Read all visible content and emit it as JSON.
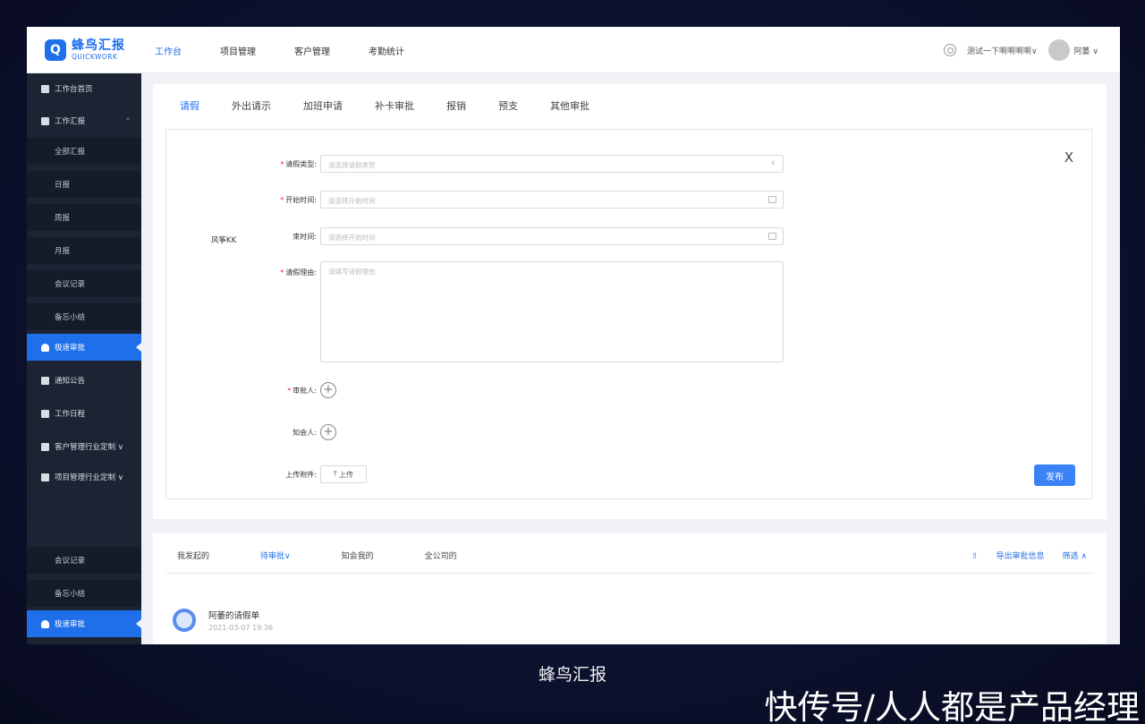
{
  "app": {
    "logo_cn": "蜂鸟汇报",
    "logo_en": "QUICKWORK",
    "brand_color": "#1f6feb"
  },
  "topnav": {
    "items": [
      "工作台",
      "项目管理",
      "客户管理",
      "考勤统计"
    ],
    "active_index": 0,
    "company": "测试一下啊啊啊啊∨",
    "user": "阿萎 ∨"
  },
  "sidebar": {
    "items": [
      {
        "label": "工作台首页",
        "icon": "grid-icon"
      },
      {
        "label": "工作汇报",
        "icon": "microphone-icon",
        "expanded": true
      },
      {
        "label": "全部汇报"
      },
      {
        "label": "日报"
      },
      {
        "label": "周报"
      },
      {
        "label": "月报"
      },
      {
        "label": "会议记录"
      },
      {
        "label": "备忘小结"
      },
      {
        "label": "极速审批",
        "icon": "user-icon",
        "active": true
      },
      {
        "label": "通知公告",
        "icon": "speaker-icon"
      },
      {
        "label": "工作日程",
        "icon": "calendar-icon"
      },
      {
        "label": "客户管理行业定制 ∨",
        "icon": "users-icon"
      },
      {
        "label": "项目管理行业定制 ∨",
        "icon": "folder-icon"
      },
      {
        "label": "会议记录"
      },
      {
        "label": "备忘小结"
      },
      {
        "label": "极速审批",
        "icon": "user-icon",
        "active": true
      }
    ]
  },
  "approval_tabs": [
    "请假",
    "外出请示",
    "加班申请",
    "补卡审批",
    "报销",
    "预支",
    "其他审批"
  ],
  "form": {
    "leave_type_label": "请假类型:",
    "leave_type_placeholder": "请选择请假类型",
    "start_label": "开始时间:",
    "start_placeholder": "请选择开始时间",
    "end_label": "结束时间:",
    "end_label_visible": "束时间:",
    "end_placeholder": "请选择开始时间",
    "reason_label": "请假理由:",
    "reason_placeholder": "请填写请假理由",
    "approver_label": "审批人:",
    "cc_label": "知会人:",
    "attachment_label": "上传附件:",
    "upload_button": "上传",
    "publish_button": "发布",
    "close_symbol": "X",
    "tooltip_user": "风筝KK"
  },
  "list_panel": {
    "tabs": [
      "我发起的",
      "待审批∨",
      "知会我的",
      "全公司的"
    ],
    "active_index": 1,
    "export_label": "导出审批信息",
    "filter_label": "筛选 ∧",
    "items": [
      {
        "title": "阿萎的请假单",
        "time": "2021-03-07 19:36"
      }
    ]
  },
  "overlay": {
    "caption": "蜂鸟汇报",
    "watermark": "快传号/人人都是产品经理"
  }
}
